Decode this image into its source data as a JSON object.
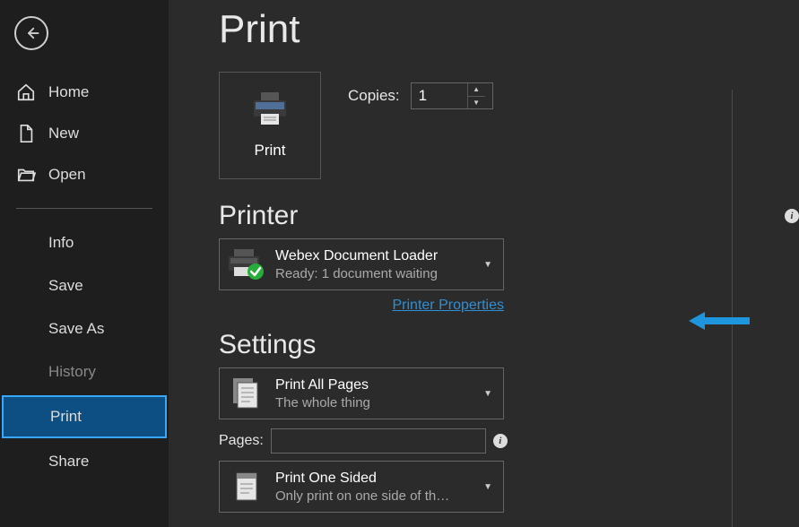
{
  "sidebar": {
    "top_items": [
      {
        "label": "Home"
      },
      {
        "label": "New"
      },
      {
        "label": "Open"
      }
    ],
    "sub_items": [
      {
        "label": "Info"
      },
      {
        "label": "Save"
      },
      {
        "label": "Save As"
      },
      {
        "label": "History"
      },
      {
        "label": "Print"
      },
      {
        "label": "Share"
      }
    ]
  },
  "page": {
    "title": "Print"
  },
  "print_button": {
    "label": "Print"
  },
  "copies": {
    "label": "Copies:",
    "value": "1"
  },
  "sections": {
    "printer": "Printer",
    "settings": "Settings"
  },
  "printer_dd": {
    "title": "Webex Document Loader",
    "sub": "Ready: 1 document waiting"
  },
  "printer_props_link": "Printer Properties",
  "settings_dd1": {
    "title": "Print All Pages",
    "sub": "The whole thing"
  },
  "pages": {
    "label": "Pages:",
    "value": ""
  },
  "settings_dd2": {
    "title": "Print One Sided",
    "sub": "Only print on one side of th…"
  },
  "colors": {
    "accent": "#1f95dd"
  }
}
